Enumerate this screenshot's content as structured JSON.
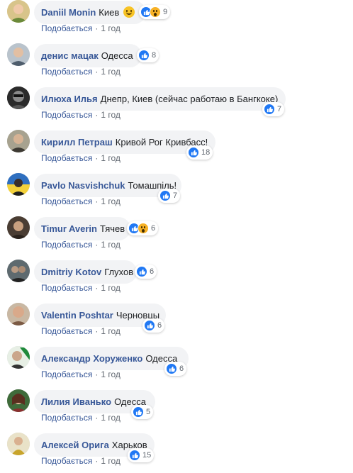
{
  "colors": {
    "author": "#385898",
    "bubble_bg": "#f2f3f5",
    "meta": "#606770",
    "like_blue": "#2078f4",
    "wow_yellow": "#f7b125"
  },
  "meta_labels": {
    "like": "Подобається",
    "separator": "·"
  },
  "comments": [
    {
      "author": "Daniil Monin",
      "text": "Киев",
      "emoji": "smile-emoji",
      "reactions": [
        "like",
        "wow"
      ],
      "count": "9",
      "time": "1 год"
    },
    {
      "author": "денис мацак",
      "text": "Одесса",
      "reactions": [
        "like"
      ],
      "count": "8",
      "time": "1 год"
    },
    {
      "author": "Илюха Илья",
      "text": "Днепр, Киев (сейчас работаю в Бангкоке)",
      "reactions": [
        "like"
      ],
      "count": "7",
      "time": "1 год"
    },
    {
      "author": "Кирилл Петраш",
      "text": "Кривой Рог Кривбасс!",
      "reactions": [
        "like"
      ],
      "count": "18",
      "time": "1 год"
    },
    {
      "author": "Pavlo Nasvishchuk",
      "text": "Томашпіль!",
      "reactions": [
        "like"
      ],
      "count": "7",
      "time": "1 год"
    },
    {
      "author": "Timur Averin",
      "text": "Тячев",
      "reactions": [
        "like",
        "wow"
      ],
      "count": "6",
      "time": "1 год"
    },
    {
      "author": "Dmitriy Kotov",
      "text": "Глухов",
      "reactions": [
        "like"
      ],
      "count": "6",
      "time": "1 год"
    },
    {
      "author": "Valentin Poshtar",
      "text": "Черновцы",
      "reactions": [
        "like"
      ],
      "count": "6",
      "time": "1 год"
    },
    {
      "author": "Александр Хоруженко",
      "text": "Одесса",
      "reactions": [
        "like"
      ],
      "count": "6",
      "time": "1 год"
    },
    {
      "author": "Лилия Иванько",
      "text": "Одесса",
      "reactions": [
        "like"
      ],
      "count": "5",
      "time": "1 год"
    },
    {
      "author": "Алексей Орига",
      "text": "Харьков",
      "reactions": [
        "like"
      ],
      "count": "15",
      "time": "1 год"
    }
  ]
}
